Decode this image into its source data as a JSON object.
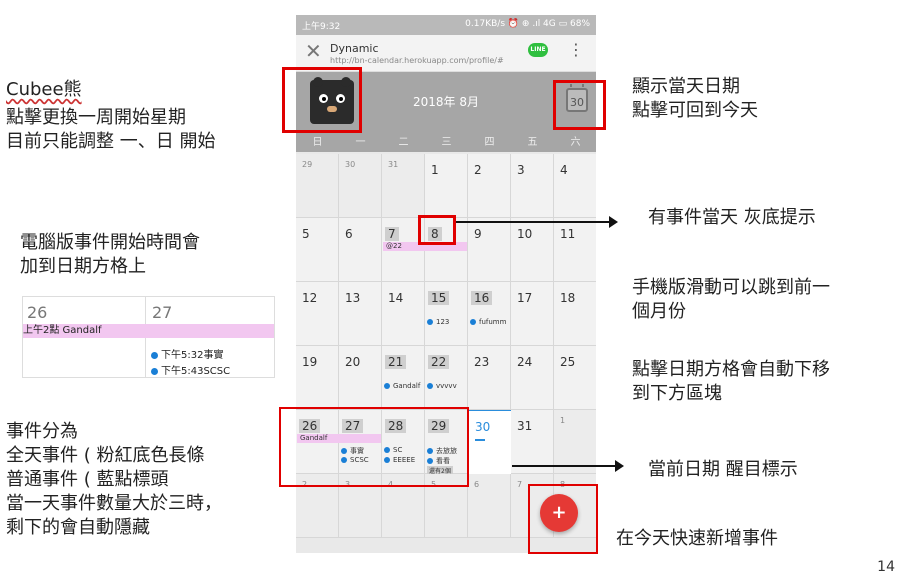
{
  "phone": {
    "status": {
      "time": "上午9:32",
      "right": "0.17KB/s ⏰ ⊕ .ıl 4G ▭ 68%"
    },
    "browser": {
      "title": "Dynamic",
      "url": "http://bn-calendar.herokuapp.com/profile/#",
      "line_badge": "LINE"
    },
    "calendar": {
      "month_title": "2018年 8月",
      "today_icon_text": "30",
      "weekdays": [
        "日",
        "一",
        "二",
        "三",
        "四",
        "五",
        "六"
      ],
      "weeks": [
        [
          {
            "d": "29",
            "o": true
          },
          {
            "d": "30",
            "o": true
          },
          {
            "d": "31",
            "o": true
          },
          {
            "d": "1"
          },
          {
            "d": "2"
          },
          {
            "d": "3"
          },
          {
            "d": "4"
          }
        ],
        [
          {
            "d": "5"
          },
          {
            "d": "6"
          },
          {
            "d": "7",
            "g": true
          },
          {
            "d": "8",
            "g": true
          },
          {
            "d": "9"
          },
          {
            "d": "10"
          },
          {
            "d": "11"
          }
        ],
        [
          {
            "d": "12"
          },
          {
            "d": "13"
          },
          {
            "d": "14"
          },
          {
            "d": "15",
            "g": true,
            "ev": [
              "123"
            ]
          },
          {
            "d": "16",
            "g": true,
            "ev": [
              "fufumm"
            ]
          },
          {
            "d": "17"
          },
          {
            "d": "18"
          }
        ],
        [
          {
            "d": "19"
          },
          {
            "d": "20"
          },
          {
            "d": "21",
            "g": true,
            "ev": [
              "Gandalf"
            ]
          },
          {
            "d": "22",
            "g": true,
            "ev": [
              "vvvvv"
            ]
          },
          {
            "d": "23"
          },
          {
            "d": "24"
          },
          {
            "d": "25"
          }
        ],
        [
          {
            "d": "26",
            "g": true
          },
          {
            "d": "27",
            "g": true,
            "ev": [
              "事實",
              "SCSC"
            ]
          },
          {
            "d": "28",
            "g": true,
            "ev": [
              "SC",
              "EEEEE"
            ]
          },
          {
            "d": "29",
            "g": true,
            "ev": [
              "去旅旅",
              "看看"
            ],
            "more": "還有2個"
          },
          {
            "d": "30",
            "today": true
          },
          {
            "d": "31"
          },
          {
            "d": "1",
            "o": true
          }
        ],
        [
          {
            "d": "2",
            "o": true
          },
          {
            "d": "3",
            "o": true
          },
          {
            "d": "4",
            "o": true
          },
          {
            "d": "5",
            "o": true
          },
          {
            "d": "6",
            "o": true
          },
          {
            "d": "7",
            "o": true
          },
          {
            "d": "8",
            "o": true
          }
        ]
      ],
      "allday_bars": {
        "week2": "@22",
        "week5": "Gandalf"
      },
      "fab_label": "+"
    }
  },
  "annotations": {
    "brand": "Cubee熊",
    "start_week": [
      "點擊更換一周開始星期",
      "目前只能調整 一、日 開始"
    ],
    "desktop_note": [
      "電腦版事件開始時間會",
      "加到日期方格上"
    ],
    "event_types": [
      "事件分為",
      "全天事件 ( 粉紅底色長條",
      "普通事件 ( 藍點標頭",
      "當一天事件數量大於三時，",
      "剩下的會自動隱藏"
    ],
    "today_btn": [
      "顯示當天日期",
      "點擊可回到今天"
    ],
    "gray_day": "有事件當天 灰底提示",
    "swipe": [
      "手機版滑動可以跳到前一",
      "個月份"
    ],
    "tap_cell": [
      "點擊日期方格會自動下移",
      "到下方區塊"
    ],
    "current_day": "當前日期 醒目標示",
    "quick_add": "在今天快速新增事件",
    "page_number": "14"
  },
  "desktop_inset": {
    "days": [
      "26",
      "27"
    ],
    "allday_text": "上午2點 Gandalf",
    "events": [
      "下午5:32事實",
      "下午5:43SCSC"
    ]
  }
}
